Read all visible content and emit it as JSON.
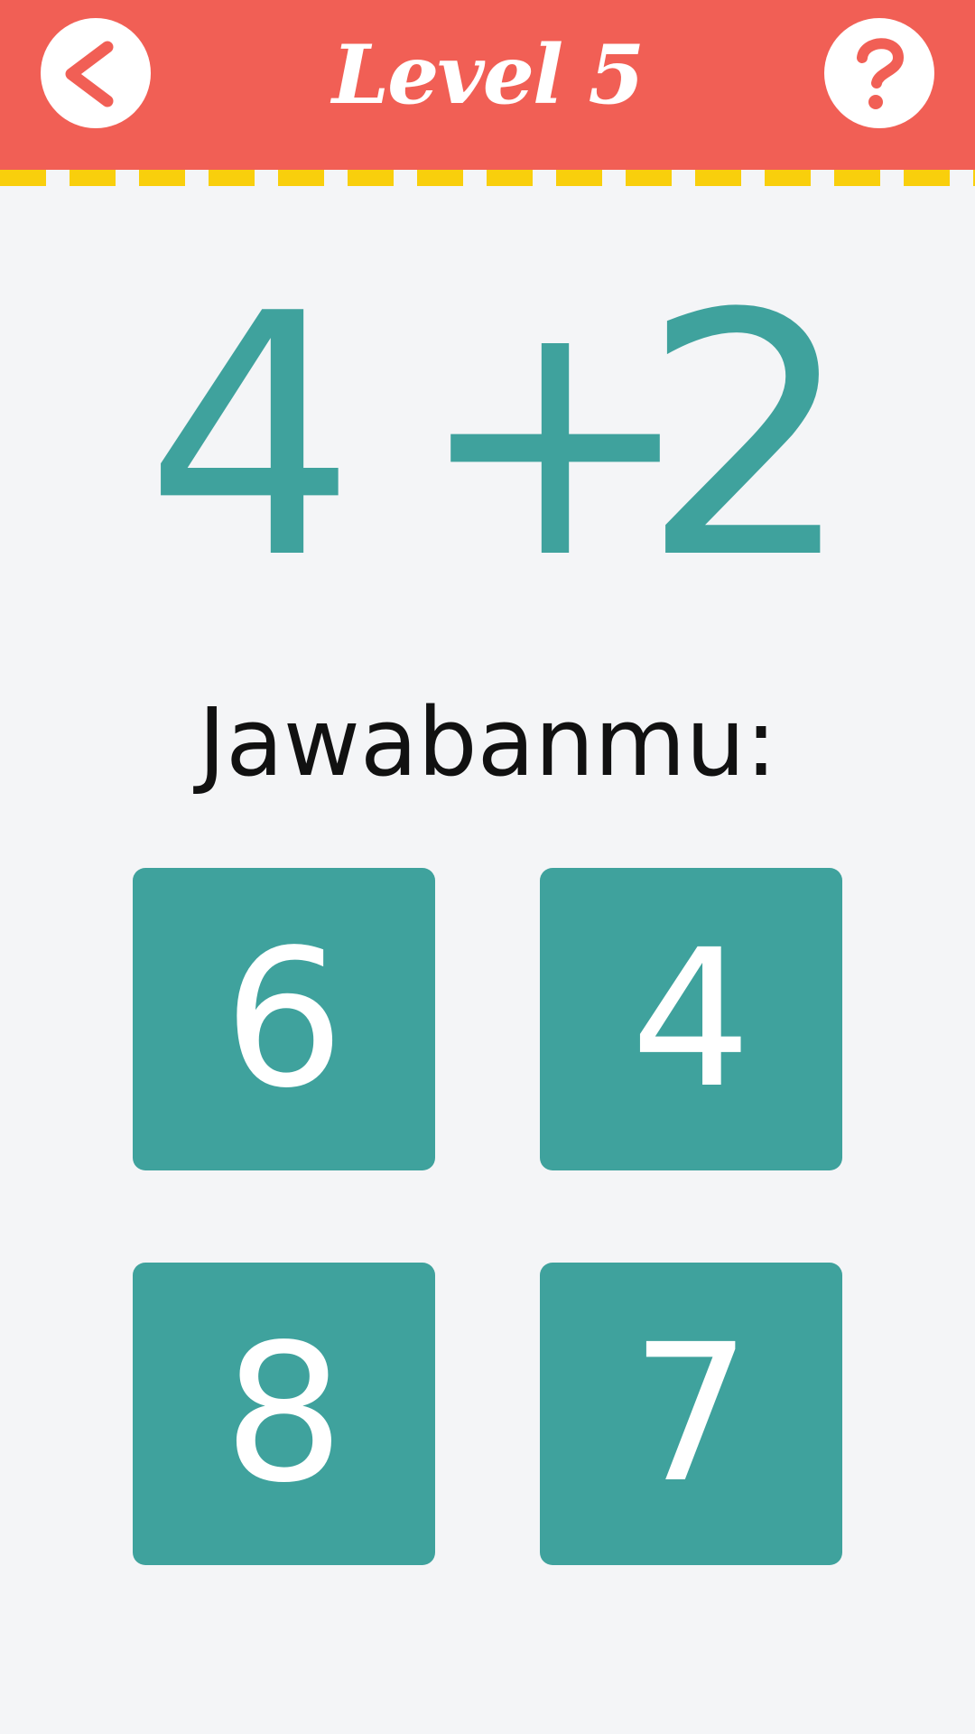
{
  "header": {
    "title": "Level 5",
    "back_icon": "chevron-left-icon",
    "help_icon": "question-icon",
    "bg_color": "#f15f55",
    "accent_color": "#f9cf0c"
  },
  "problem": {
    "operand_a": "4",
    "operator": "+",
    "operand_b": "2",
    "color": "#3fa29d"
  },
  "prompt": "Jawabanmu:",
  "answers": [
    "6",
    "4",
    "8",
    "7"
  ]
}
